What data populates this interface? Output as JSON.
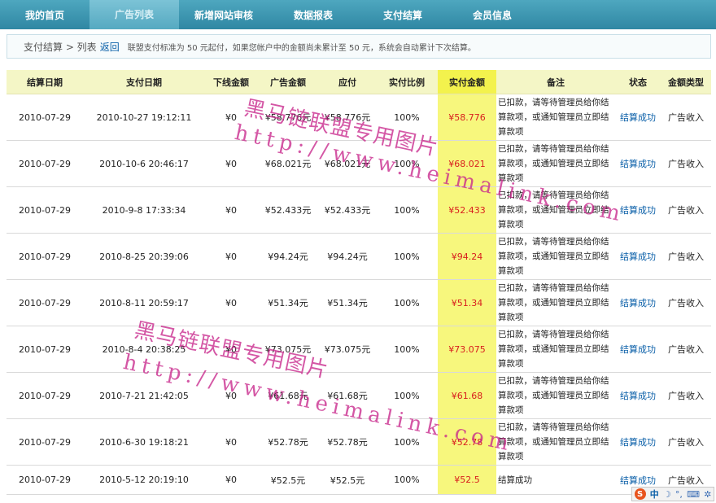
{
  "nav": {
    "items": [
      {
        "label": "我的首页"
      },
      {
        "label": "广告列表"
      },
      {
        "label": "新增网站审核"
      },
      {
        "label": "数据报表"
      },
      {
        "label": "支付结算"
      },
      {
        "label": "会员信息"
      }
    ]
  },
  "crumb": {
    "path": "支付结算 > 列表",
    "back": "返回",
    "notice": "联盟支付标准为 50 元起付，如果您帐户中的金额尚未累计至 50 元，系统会自动累计下次结算。"
  },
  "table": {
    "headers": [
      "结算日期",
      "支付日期",
      "下线金额",
      "广告金额",
      "应付",
      "实付比例",
      "实付金额",
      "备注",
      "状态",
      "金额类型"
    ],
    "rows": [
      {
        "settle_date": "2010-07-29",
        "pay_date": "2010-10-27 19:12:11",
        "downline": "¥0",
        "ad_amount": "¥58.776元",
        "payable": "¥58.776元",
        "ratio": "100%",
        "paid": "¥58.776",
        "remark": "已扣款，请等待管理员给你结算款项，或通知管理员立即结算款项",
        "status": "结算成功",
        "amount_type": "广告收入"
      },
      {
        "settle_date": "2010-07-29",
        "pay_date": "2010-10-6 20:46:17",
        "downline": "¥0",
        "ad_amount": "¥68.021元",
        "payable": "¥68.021元",
        "ratio": "100%",
        "paid": "¥68.021",
        "remark": "已扣款，请等待管理员给你结算款项，或通知管理员立即结算款项",
        "status": "结算成功",
        "amount_type": "广告收入"
      },
      {
        "settle_date": "2010-07-29",
        "pay_date": "2010-9-8 17:33:34",
        "downline": "¥0",
        "ad_amount": "¥52.433元",
        "payable": "¥52.433元",
        "ratio": "100%",
        "paid": "¥52.433",
        "remark": "已扣款，请等待管理员给你结算款项，或通知管理员立即结算款项",
        "status": "结算成功",
        "amount_type": "广告收入"
      },
      {
        "settle_date": "2010-07-29",
        "pay_date": "2010-8-25 20:39:06",
        "downline": "¥0",
        "ad_amount": "¥94.24元",
        "payable": "¥94.24元",
        "ratio": "100%",
        "paid": "¥94.24",
        "remark": "已扣款，请等待管理员给你结算款项，或通知管理员立即结算款项",
        "status": "结算成功",
        "amount_type": "广告收入"
      },
      {
        "settle_date": "2010-07-29",
        "pay_date": "2010-8-11 20:59:17",
        "downline": "¥0",
        "ad_amount": "¥51.34元",
        "payable": "¥51.34元",
        "ratio": "100%",
        "paid": "¥51.34",
        "remark": "已扣款，请等待管理员给你结算款项，或通知管理员立即结算款项",
        "status": "结算成功",
        "amount_type": "广告收入"
      },
      {
        "settle_date": "2010-07-29",
        "pay_date": "2010-8-4 20:38:25",
        "downline": "¥0",
        "ad_amount": "¥73.075元",
        "payable": "¥73.075元",
        "ratio": "100%",
        "paid": "¥73.075",
        "remark": "已扣款，请等待管理员给你结算款项，或通知管理员立即结算款项",
        "status": "结算成功",
        "amount_type": "广告收入"
      },
      {
        "settle_date": "2010-07-29",
        "pay_date": "2010-7-21 21:42:05",
        "downline": "¥0",
        "ad_amount": "¥61.68元",
        "payable": "¥61.68元",
        "ratio": "100%",
        "paid": "¥61.68",
        "remark": "已扣款，请等待管理员给你结算款项，或通知管理员立即结算款项",
        "status": "结算成功",
        "amount_type": "广告收入"
      },
      {
        "settle_date": "2010-07-29",
        "pay_date": "2010-6-30 19:18:21",
        "downline": "¥0",
        "ad_amount": "¥52.78元",
        "payable": "¥52.78元",
        "ratio": "100%",
        "paid": "¥52.78",
        "remark": "已扣款，请等待管理员给你结算款项，或通知管理员立即结算款项",
        "status": "结算成功",
        "amount_type": "广告收入"
      },
      {
        "settle_date": "2010-07-29",
        "pay_date": "2010-5-12 20:19:10",
        "downline": "¥0",
        "ad_amount": "¥52.5元",
        "payable": "¥52.5元",
        "ratio": "100%",
        "paid": "¥52.5",
        "remark": "结算成功",
        "status": "结算成功",
        "amount_type": "广告收入"
      }
    ]
  },
  "watermarks": [
    {
      "text": "黑马链联盟专用图片"
    },
    {
      "text": "http://www.heimalink.com"
    },
    {
      "text": "黑马链联盟专用图片"
    },
    {
      "text": "http://www.heimalink.com"
    }
  ],
  "ime": {
    "logo": "S",
    "mode": "中",
    "icons": [
      "moon-icon",
      "punctuation-icon",
      "keyboard-icon",
      "settings-icon"
    ]
  },
  "colors": {
    "nav_bg": "#3a94b0",
    "header_bg": "#f4f6c6",
    "paid_column_bg": "#f7f77d",
    "paid_text": "#d81e1e",
    "status_link": "#0a5fa8",
    "watermark": "#c8288c"
  }
}
